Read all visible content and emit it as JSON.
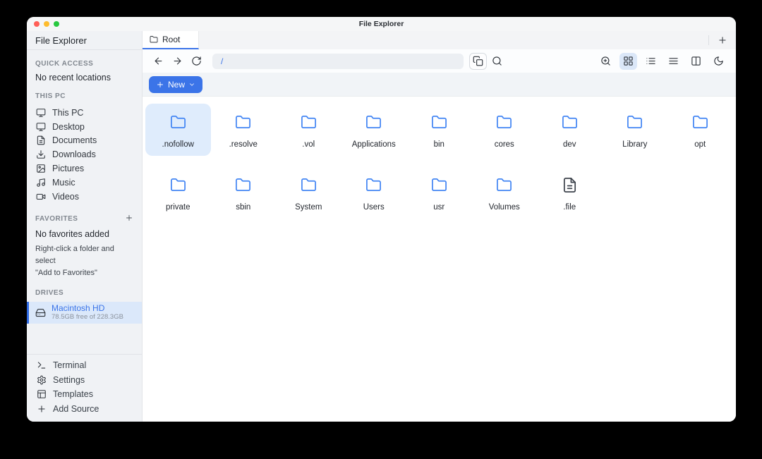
{
  "window": {
    "title": "File Explorer"
  },
  "sidebar": {
    "header": "File Explorer",
    "quick_access": {
      "label": "QUICK ACCESS",
      "empty": "No recent locations"
    },
    "this_pc": {
      "label": "THIS PC",
      "items": [
        {
          "label": "This PC",
          "icon": "monitor-icon"
        },
        {
          "label": "Desktop",
          "icon": "monitor-icon"
        },
        {
          "label": "Documents",
          "icon": "document-icon"
        },
        {
          "label": "Downloads",
          "icon": "download-icon"
        },
        {
          "label": "Pictures",
          "icon": "image-icon"
        },
        {
          "label": "Music",
          "icon": "music-icon"
        },
        {
          "label": "Videos",
          "icon": "video-icon"
        }
      ]
    },
    "favorites": {
      "label": "FAVORITES",
      "empty_title": "No favorites added",
      "hint_line1": "Right-click a folder and select",
      "hint_line2": "\"Add to Favorites\""
    },
    "drives": {
      "label": "DRIVES",
      "items": [
        {
          "name": "Macintosh HD",
          "detail": "78.5GB free of 228.3GB",
          "selected": true,
          "icon": "hard-drive-icon"
        }
      ]
    },
    "footer": [
      {
        "label": "Terminal",
        "icon": "terminal-icon"
      },
      {
        "label": "Settings",
        "icon": "gear-icon"
      },
      {
        "label": "Templates",
        "icon": "templates-icon"
      },
      {
        "label": "Add Source",
        "icon": "plus-icon"
      }
    ]
  },
  "tabs": {
    "items": [
      {
        "label": "Root",
        "active": true,
        "icon": "folder-icon"
      }
    ],
    "new_tab_icon": "plus-icon"
  },
  "toolbar": {
    "path_value": "/",
    "nav_icons": [
      "back-icon",
      "forward-icon",
      "refresh-icon"
    ],
    "action_icons": [
      "copy-path-icon",
      "search-icon"
    ],
    "view_icons": [
      "zoom-in-icon",
      "grid-view-icon",
      "list-view-icon",
      "detail-view-icon",
      "split-view-icon",
      "dark-mode-icon"
    ],
    "active_view": "grid-view"
  },
  "actions": {
    "new_button_label": "New"
  },
  "files": {
    "items": [
      {
        "name": ".nofollow",
        "type": "folder",
        "selected": true
      },
      {
        "name": ".resolve",
        "type": "folder"
      },
      {
        "name": ".vol",
        "type": "folder"
      },
      {
        "name": "Applications",
        "type": "folder"
      },
      {
        "name": "bin",
        "type": "folder"
      },
      {
        "name": "cores",
        "type": "folder"
      },
      {
        "name": "dev",
        "type": "folder"
      },
      {
        "name": "Library",
        "type": "folder"
      },
      {
        "name": "opt",
        "type": "folder"
      },
      {
        "name": "private",
        "type": "folder"
      },
      {
        "name": "sbin",
        "type": "folder"
      },
      {
        "name": "System",
        "type": "folder"
      },
      {
        "name": "Users",
        "type": "folder"
      },
      {
        "name": "usr",
        "type": "folder"
      },
      {
        "name": "Volumes",
        "type": "folder"
      },
      {
        "name": ".file",
        "type": "file"
      }
    ]
  },
  "colors": {
    "accent": "#3b74e8",
    "folder_icon": "#4285f4",
    "selection_bg": "#dfecfc",
    "drive_selection_bg": "#dbe8fa",
    "sidebar_bg": "#f0f2f5",
    "traffic_red": "#ff5f57",
    "traffic_yellow": "#febc2e",
    "traffic_green": "#28c840"
  }
}
